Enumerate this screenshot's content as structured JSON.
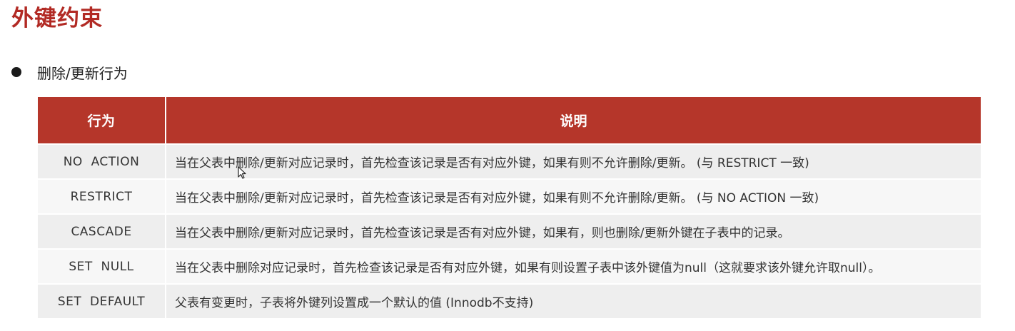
{
  "title": "外键约束",
  "bullet": "删除/更新行为",
  "table": {
    "headers": [
      "行为",
      "说明"
    ],
    "rows": [
      {
        "action": "NO  ACTION",
        "description": "当在父表中删除/更新对应记录时，首先检查该记录是否有对应外键，如果有则不允许删除/更新。 (与 RESTRICT 一致)"
      },
      {
        "action": "RESTRICT",
        "description": "当在父表中删除/更新对应记录时，首先检查该记录是否有对应外键，如果有则不允许删除/更新。 (与 NO ACTION 一致)"
      },
      {
        "action": "CASCADE",
        "description": "当在父表中删除/更新对应记录时，首先检查该记录是否有对应外键，如果有，则也删除/更新外键在子表中的记录。"
      },
      {
        "action": "SET  NULL",
        "description": "当在父表中删除对应记录时，首先检查该记录是否有对应外键，如果有则设置子表中该外键值为null（这就要求该外键允许取null）。"
      },
      {
        "action": "SET  DEFAULT",
        "description": "父表有变更时，子表将外键列设置成一个默认的值 (Innodb不支持)"
      }
    ]
  },
  "colors": {
    "title": "#b22a24",
    "header_bg": "#b5362a",
    "row_odd": "#eeeeee",
    "row_even": "#f7f7f7"
  },
  "icons": {
    "bullet": "bullet-dot-icon",
    "cursor": "mouse-pointer-icon"
  }
}
